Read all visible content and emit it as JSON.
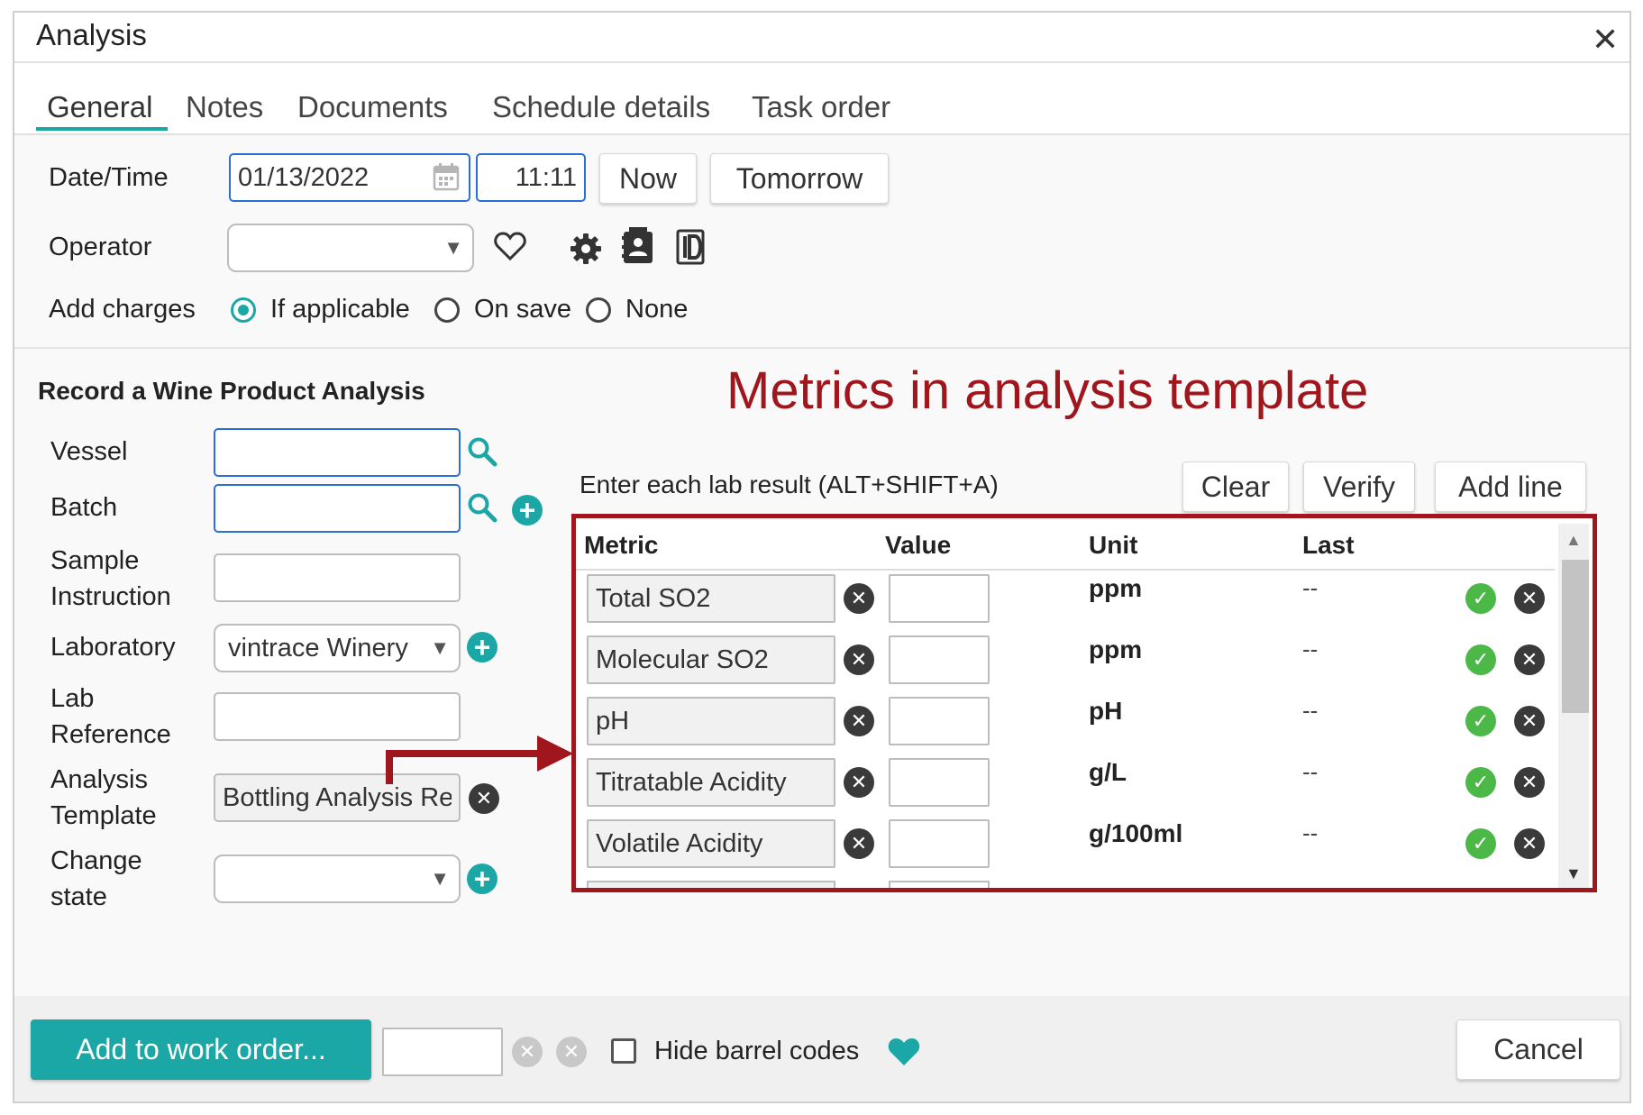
{
  "dialog": {
    "title": "Analysis"
  },
  "tabs": [
    "General",
    "Notes",
    "Documents",
    "Schedule details",
    "Task order"
  ],
  "general": {
    "datetime_label": "Date/Time",
    "date_value": "01/13/2022",
    "time_value": "11:11",
    "now_label": "Now",
    "tomorrow_label": "Tomorrow",
    "operator_label": "Operator",
    "add_charges_label": "Add charges",
    "charge_options": [
      "If applicable",
      "On save",
      "None"
    ]
  },
  "record": {
    "title": "Record a Wine Product Analysis",
    "vessel_label": "Vessel",
    "batch_label": "Batch",
    "sample_label_1": "Sample",
    "sample_label_2": "Instruction",
    "laboratory_label": "Laboratory",
    "laboratory_value": "vintrace Winery",
    "labref_label_1": "Lab",
    "labref_label_2": "Reference",
    "template_label_1": "Analysis",
    "template_label_2": "Template",
    "template_value": "Bottling Analysis Re",
    "change_state_label_1": "Change",
    "change_state_label_2": "state"
  },
  "annotation": "Metrics in analysis template",
  "metrics": {
    "instruction": "Enter each lab result (ALT+SHIFT+A)",
    "clear_label": "Clear",
    "verify_label": "Verify",
    "add_line_label": "Add line",
    "columns": [
      "Metric",
      "Value",
      "Unit",
      "Last"
    ],
    "rows": [
      {
        "metric": "Total SO2",
        "unit": "ppm",
        "last": "--"
      },
      {
        "metric": "Molecular SO2",
        "unit": "ppm",
        "last": "--"
      },
      {
        "metric": "pH",
        "unit": "pH",
        "last": "--"
      },
      {
        "metric": "Titratable Acidity",
        "unit": "g/L",
        "last": "--"
      },
      {
        "metric": "Volatile Acidity",
        "unit": "g/100ml",
        "last": "--"
      }
    ]
  },
  "footer": {
    "add_to_work_order_label": "Add to work order...",
    "hide_barrel_codes_label": "Hide barrel codes",
    "cancel_label": "Cancel"
  },
  "colors": {
    "accent": "#1ba7a6",
    "annotation": "#a0161d",
    "check": "#4cb848"
  },
  "icons": [
    "close-icon",
    "calendar-icon",
    "heart-icon",
    "gear-icon",
    "contact-card-icon",
    "document-id-icon",
    "search-icon",
    "add-icon",
    "remove-icon",
    "check-icon"
  ]
}
